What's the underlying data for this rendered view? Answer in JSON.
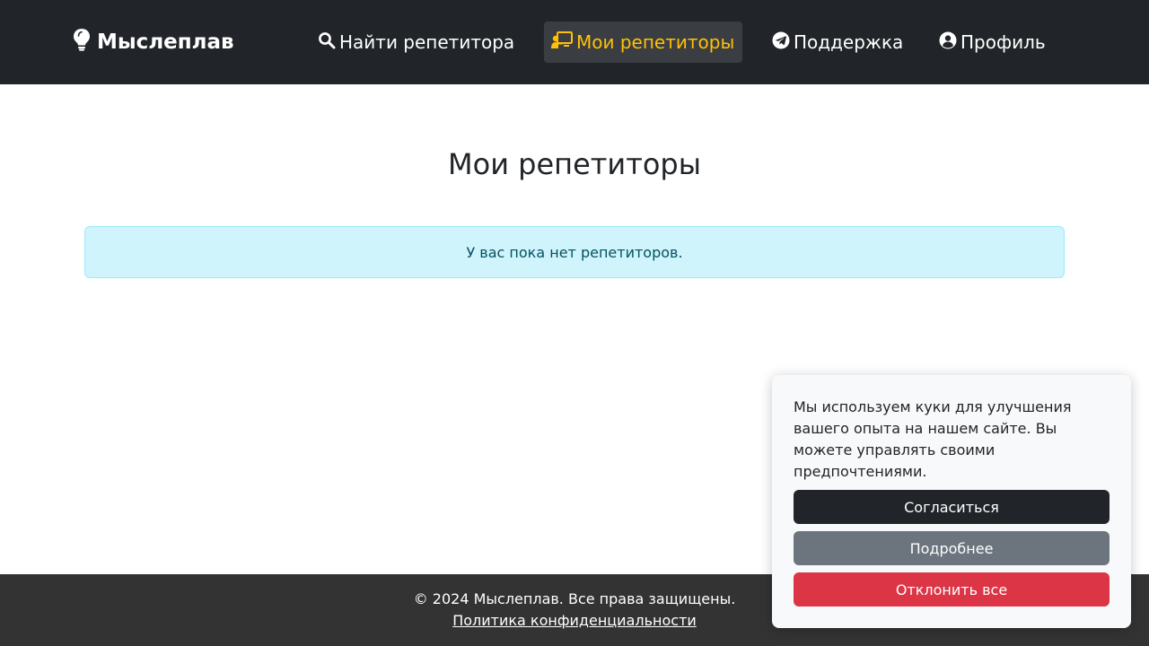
{
  "brand": {
    "name": "Мыслеплав",
    "icon": "lightbulb-icon"
  },
  "nav": {
    "items": [
      {
        "label": "Найти репетитора",
        "icon": "search-icon",
        "active": false
      },
      {
        "label": "Мои репетиторы",
        "icon": "chalkboard-teacher-icon",
        "active": true
      },
      {
        "label": "Поддержка",
        "icon": "telegram-icon",
        "active": false
      },
      {
        "label": "Профиль",
        "icon": "user-circle-icon",
        "active": false
      }
    ]
  },
  "main": {
    "title": "Мои репетиторы",
    "empty_message": "У вас пока нет репетиторов."
  },
  "footer": {
    "copyright": "© 2024 Мыслеплав. Все права защищены.",
    "privacy_link": "Политика конфиденциальности"
  },
  "cookie_banner": {
    "text": "Мы используем куки для улучшения вашего опыта на нашем сайте. Вы можете управлять своими предпочтениями.",
    "accept_label": "Согласиться",
    "more_label": "Подробнее",
    "decline_label": "Отклонить все"
  },
  "colors": {
    "navbar_bg": "#212529",
    "active_accent": "#ffc107",
    "alert_bg": "#cff4fc",
    "alert_text": "#055160",
    "footer_bg": "#333333",
    "accept_bg": "#212529",
    "more_bg": "#6c757d",
    "decline_bg": "#dc3545"
  }
}
